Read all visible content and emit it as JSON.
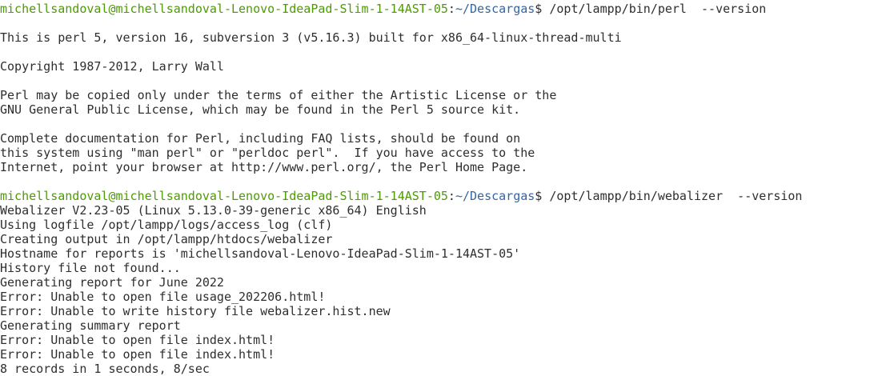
{
  "prompt": {
    "user_host": "michellsandoval@michellsandoval-Lenovo-IdeaPad-Slim-1-14AST-05",
    "colon": ":",
    "path": "~/Descargas",
    "dollar": "$ "
  },
  "colors": {
    "prompt_user": "#4e9a06",
    "prompt_path": "#3465a4",
    "text": "#2e2e2e",
    "background": "#ffffff"
  },
  "commands": [
    "/opt/lampp/bin/perl  --version",
    "/opt/lampp/bin/webalizer  --version"
  ],
  "perl_output": [
    "",
    "This is perl 5, version 16, subversion 3 (v5.16.3) built for x86_64-linux-thread-multi",
    "",
    "Copyright 1987-2012, Larry Wall",
    "",
    "Perl may be copied only under the terms of either the Artistic License or the",
    "GNU General Public License, which may be found in the Perl 5 source kit.",
    "",
    "Complete documentation for Perl, including FAQ lists, should be found on",
    "this system using \"man perl\" or \"perldoc perl\".  If you have access to the",
    "Internet, point your browser at http://www.perl.org/, the Perl Home Page.",
    ""
  ],
  "webalizer_output": [
    "Webalizer V2.23-05 (Linux 5.13.0-39-generic x86_64) English",
    "Using logfile /opt/lampp/logs/access_log (clf)",
    "Creating output in /opt/lampp/htdocs/webalizer",
    "Hostname for reports is 'michellsandoval-Lenovo-IdeaPad-Slim-1-14AST-05'",
    "History file not found...",
    "Generating report for June 2022",
    "Error: Unable to open file usage_202206.html!",
    "Error: Unable to write history file webalizer.hist.new",
    "Generating summary report",
    "Error: Unable to open file index.html!",
    "Error: Unable to open file index.html!",
    "8 records in 1 seconds, 8/sec"
  ]
}
